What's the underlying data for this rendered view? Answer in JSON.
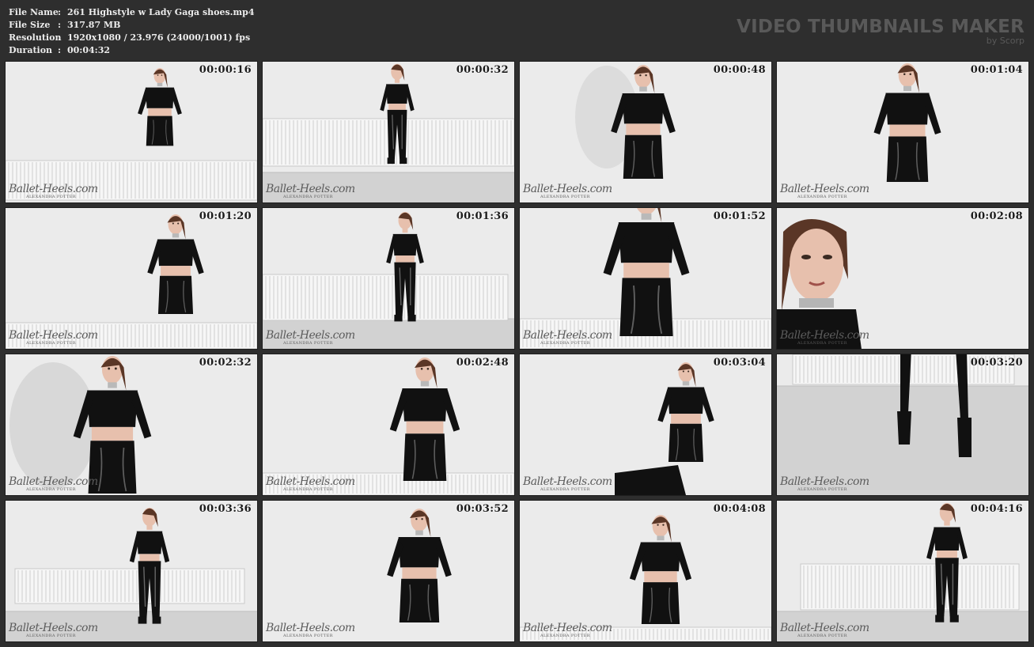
{
  "file_info": {
    "rows": [
      {
        "key": "File Name",
        "sep": ":",
        "value": "261 Highstyle w Lady Gaga shoes.mp4"
      },
      {
        "key": "File Size",
        "sep": ":",
        "value": "317.87 MB"
      },
      {
        "key": "Resolution",
        "sep": ":",
        "value": "1920x1080 / 23.976 (24000/1001) fps"
      },
      {
        "key": "Duration",
        "sep": ":",
        "value": "00:04:32"
      }
    ]
  },
  "brand": {
    "title": "VIDEO THUMBNAILS MAKER",
    "subtitle": "by Scorp"
  },
  "watermark": {
    "main": "Ballet-Heels.com",
    "sub": "ALEXANDRA POTTER"
  },
  "thumbnails": [
    {
      "time": "00:00:16",
      "scene": "standing-radiator-wide"
    },
    {
      "time": "00:00:32",
      "scene": "walking-side"
    },
    {
      "time": "00:00:48",
      "scene": "torso-arms-out"
    },
    {
      "time": "00:01:04",
      "scene": "torso-front"
    },
    {
      "time": "00:01:20",
      "scene": "leaning-radiator"
    },
    {
      "time": "00:01:36",
      "scene": "side-full-body"
    },
    {
      "time": "00:01:52",
      "scene": "hips-closeup"
    },
    {
      "time": "00:02:08",
      "scene": "face-closeup"
    },
    {
      "time": "00:02:32",
      "scene": "talking-closeup"
    },
    {
      "time": "00:02:48",
      "scene": "bending-forward"
    },
    {
      "time": "00:03:04",
      "scene": "crouching-wall"
    },
    {
      "time": "00:03:20",
      "scene": "legs-heels"
    },
    {
      "time": "00:03:36",
      "scene": "arms-up-full"
    },
    {
      "time": "00:03:52",
      "scene": "hands-behind-head"
    },
    {
      "time": "00:04:08",
      "scene": "back-view"
    },
    {
      "time": "00:04:16",
      "scene": "full-body-radiator"
    }
  ],
  "colors": {
    "background": "#2e2e2e",
    "thumb_background": "#ebebeb",
    "clothing": "#111111",
    "skin": "#e7c0ad",
    "hair": "#5a3626",
    "radiator": "#f6f6f6"
  }
}
